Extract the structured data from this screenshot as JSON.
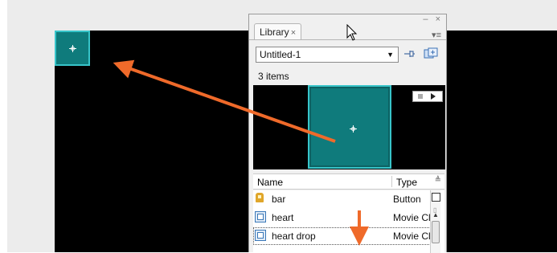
{
  "library_panel": {
    "tab_label": "Library",
    "tab_close": "×",
    "window_controls": "– ×",
    "menu_glyph": "▾≡",
    "document": "Untitled-1",
    "item_count": "3 items",
    "columns": {
      "name": "Name",
      "type": "Type"
    },
    "items": [
      {
        "name": "bar",
        "type": "Button",
        "icon": "button-symbol-icon"
      },
      {
        "name": "heart",
        "type": "Movie Clip",
        "icon": "movieclip-symbol-icon"
      },
      {
        "name": "heart drop",
        "type": "Movie Clip",
        "icon": "movieclip-symbol-icon"
      }
    ]
  },
  "colors": {
    "stage": "#000000",
    "symbol_fill": "#0f7b7c",
    "symbol_border": "#37c4c9",
    "annotation_arrow": "#ef6a2a"
  }
}
